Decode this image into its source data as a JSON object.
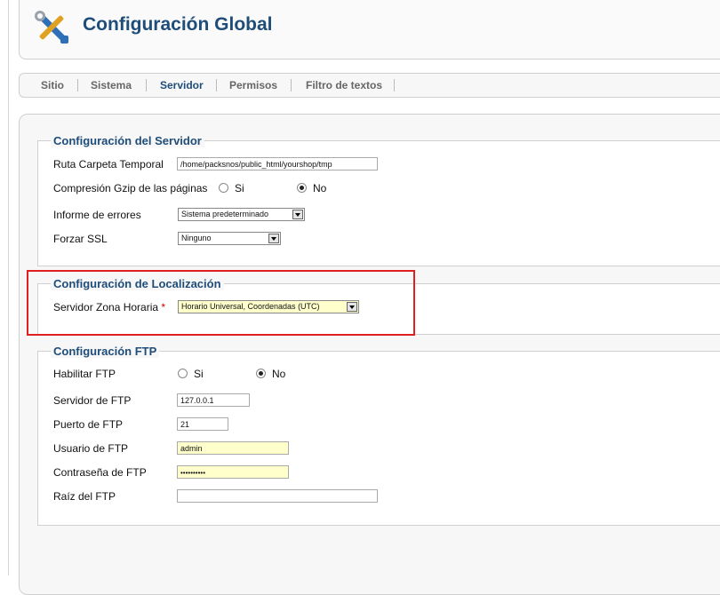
{
  "header": {
    "title": "Configuración Global",
    "icon": "tools-icon"
  },
  "tabs": [
    {
      "label": "Sitio",
      "active": false
    },
    {
      "label": "Sistema",
      "active": false
    },
    {
      "label": "Servidor",
      "active": true
    },
    {
      "label": "Permisos",
      "active": false
    },
    {
      "label": "Filtro de textos",
      "active": false
    }
  ],
  "server": {
    "legend": "Configuración del Servidor",
    "tmp_label": "Ruta Carpeta Temporal",
    "tmp_value": "/home/packsnos/public_html/yourshop/tmp",
    "gzip_label": "Compresión Gzip de las páginas",
    "gzip_yes": "Si",
    "gzip_no": "No",
    "gzip_selected": "No",
    "errors_label": "Informe de errores",
    "errors_value": "Sistema predeterminado",
    "ssl_label": "Forzar SSL",
    "ssl_value": "Ninguno"
  },
  "locale": {
    "legend": "Configuración de Localización",
    "tz_label": "Servidor Zona Horaria",
    "required_mark": "*",
    "tz_value": "Horario Universal, Coordenadas (UTC)"
  },
  "ftp": {
    "legend": "Configuración FTP",
    "enable_label": "Habilitar FTP",
    "enable_yes": "Si",
    "enable_no": "No",
    "enable_selected": "No",
    "host_label": "Servidor de FTP",
    "host_value": "127.0.0.1",
    "port_label": "Puerto de FTP",
    "port_value": "21",
    "user_label": "Usuario de FTP",
    "user_value": "admin",
    "pass_label": "Contraseña de FTP",
    "pass_value": "••••••••••",
    "root_label": "Raíz del FTP",
    "root_value": ""
  },
  "colors": {
    "accent": "#1f4d7a",
    "highlight_border": "#e02020",
    "autofill": "#ffffcc"
  }
}
